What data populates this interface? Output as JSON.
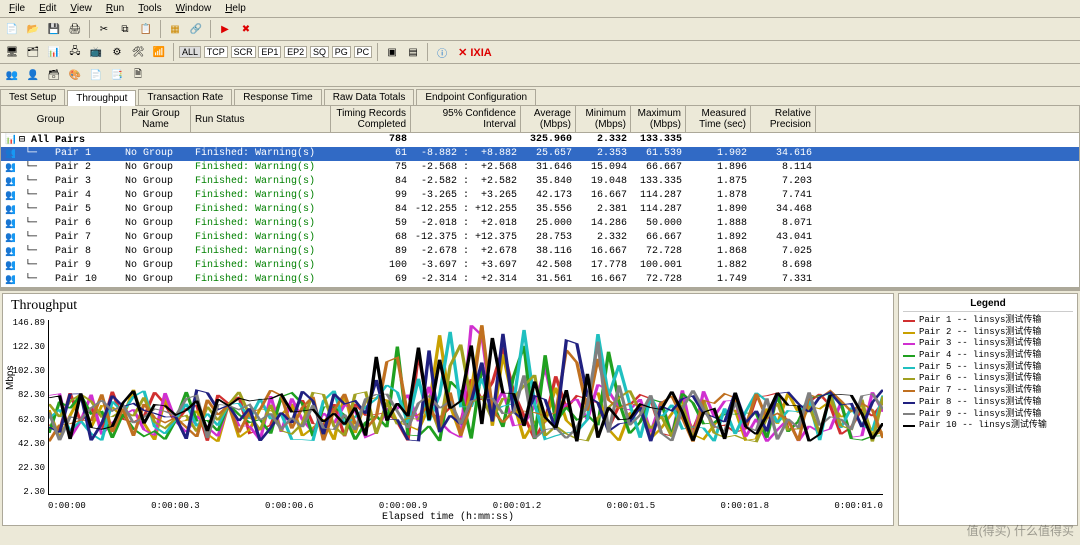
{
  "menu": [
    "File",
    "Edit",
    "View",
    "Run",
    "Tools",
    "Window",
    "Help"
  ],
  "toolbar2": {
    "modes": [
      "ALL",
      "TCP",
      "SCR",
      "EP1",
      "EP2",
      "SQ",
      "PG",
      "PC"
    ],
    "brand": "IXIA"
  },
  "tabs": [
    {
      "label": "Test Setup",
      "active": false
    },
    {
      "label": "Throughput",
      "active": true
    },
    {
      "label": "Transaction Rate",
      "active": false
    },
    {
      "label": "Response Time",
      "active": false
    },
    {
      "label": "Raw Data Totals",
      "active": false
    },
    {
      "label": "Endpoint Configuration",
      "active": false
    }
  ],
  "grid": {
    "headers": [
      "Group",
      "",
      "Pair Group Name",
      "Run Status",
      "Timing Records Completed",
      "95% Confidence Interval",
      "Average (Mbps)",
      "Minimum (Mbps)",
      "Maximum (Mbps)",
      "Measured Time (sec)",
      "Relative Precision"
    ],
    "summary": {
      "label": "All Pairs",
      "completed": "788",
      "avg": "325.960",
      "min": "2.332",
      "max": "133.335"
    },
    "rows": [
      {
        "pair": "Pair 1",
        "grp": "No Group",
        "status": "Finished: Warning(s)",
        "tr": "61",
        "ci": " -8.882 :  +8.882",
        "avg": "25.657",
        "min": "2.353",
        "max": "61.539",
        "time": "1.902",
        "prec": "34.616"
      },
      {
        "pair": "Pair 2",
        "grp": "No Group",
        "status": "Finished: Warning(s)",
        "tr": "75",
        "ci": " -2.568 :  +2.568",
        "avg": "31.646",
        "min": "15.094",
        "max": "66.667",
        "time": "1.896",
        "prec": "8.114"
      },
      {
        "pair": "Pair 3",
        "grp": "No Group",
        "status": "Finished: Warning(s)",
        "tr": "84",
        "ci": " -2.582 :  +2.582",
        "avg": "35.840",
        "min": "19.048",
        "max": "133.335",
        "time": "1.875",
        "prec": "7.203"
      },
      {
        "pair": "Pair 4",
        "grp": "No Group",
        "status": "Finished: Warning(s)",
        "tr": "99",
        "ci": " -3.265 :  +3.265",
        "avg": "42.173",
        "min": "16.667",
        "max": "114.287",
        "time": "1.878",
        "prec": "7.741"
      },
      {
        "pair": "Pair 5",
        "grp": "No Group",
        "status": "Finished: Warning(s)",
        "tr": "84",
        "ci": "-12.255 : +12.255",
        "avg": "35.556",
        "min": "2.381",
        "max": "114.287",
        "time": "1.890",
        "prec": "34.468"
      },
      {
        "pair": "Pair 6",
        "grp": "No Group",
        "status": "Finished: Warning(s)",
        "tr": "59",
        "ci": " -2.018 :  +2.018",
        "avg": "25.000",
        "min": "14.286",
        "max": "50.000",
        "time": "1.888",
        "prec": "8.071"
      },
      {
        "pair": "Pair 7",
        "grp": "No Group",
        "status": "Finished: Warning(s)",
        "tr": "68",
        "ci": "-12.375 : +12.375",
        "avg": "28.753",
        "min": "2.332",
        "max": "66.667",
        "time": "1.892",
        "prec": "43.041"
      },
      {
        "pair": "Pair 8",
        "grp": "No Group",
        "status": "Finished: Warning(s)",
        "tr": "89",
        "ci": " -2.678 :  +2.678",
        "avg": "38.116",
        "min": "16.667",
        "max": "72.728",
        "time": "1.868",
        "prec": "7.025"
      },
      {
        "pair": "Pair 9",
        "grp": "No Group",
        "status": "Finished: Warning(s)",
        "tr": "100",
        "ci": " -3.697 :  +3.697",
        "avg": "42.508",
        "min": "17.778",
        "max": "100.001",
        "time": "1.882",
        "prec": "8.698"
      },
      {
        "pair": "Pair 10",
        "grp": "No Group",
        "status": "Finished: Warning(s)",
        "tr": "69",
        "ci": " -2.314 :  +2.314",
        "avg": "31.561",
        "min": "16.667",
        "max": "72.728",
        "time": "1.749",
        "prec": "7.331"
      }
    ]
  },
  "chart": {
    "title": "Throughput",
    "ylabel": "Mbps",
    "xlabel": "Elapsed time (h:mm:ss)",
    "yticks": [
      "146.89",
      "122.30",
      "102.30",
      "82.30",
      "62.30",
      "42.30",
      "22.30",
      "2.30"
    ],
    "xticks": [
      "0:00:00",
      "0:00:00.3",
      "0:00:00.6",
      "0:00:00.9",
      "0:00:01.2",
      "0:00:01.5",
      "0:00:01.8",
      "0:00:01.0"
    ],
    "legend_title": "Legend",
    "legend": [
      {
        "name": "Pair 1 -- linsys测试传输",
        "color": "#d03030"
      },
      {
        "name": "Pair 2 -- linsys测试传输",
        "color": "#c8a000"
      },
      {
        "name": "Pair 3 -- linsys测试传输",
        "color": "#d030d0"
      },
      {
        "name": "Pair 4 -- linsys测试传输",
        "color": "#20a020"
      },
      {
        "name": "Pair 5 -- linsys测试传输",
        "color": "#20c0c0"
      },
      {
        "name": "Pair 6 -- linsys测试传输",
        "color": "#a0a020"
      },
      {
        "name": "Pair 7 -- linsys测试传输",
        "color": "#c07020"
      },
      {
        "name": "Pair 8 -- linsys测试传输",
        "color": "#202080"
      },
      {
        "name": "Pair 9 -- linsys测试传输",
        "color": "#808080"
      },
      {
        "name": "Pair 10 -- linsys测试传输",
        "color": "#000000"
      }
    ]
  },
  "chart_data": {
    "type": "line",
    "title": "Throughput",
    "xlabel": "Elapsed time (h:mm:ss)",
    "ylabel": "Mbps",
    "ylim": [
      2.3,
      146.89
    ],
    "xrange": [
      0.0,
      2.0
    ],
    "series": [
      {
        "name": "Pair 1",
        "color": "#d03030"
      },
      {
        "name": "Pair 2",
        "color": "#c8a000"
      },
      {
        "name": "Pair 3",
        "color": "#d030d0"
      },
      {
        "name": "Pair 4",
        "color": "#20a020"
      },
      {
        "name": "Pair 5",
        "color": "#20c0c0"
      },
      {
        "name": "Pair 6",
        "color": "#a0a020"
      },
      {
        "name": "Pair 7",
        "color": "#c07020"
      },
      {
        "name": "Pair 8",
        "color": "#202080"
      },
      {
        "name": "Pair 9",
        "color": "#808080"
      },
      {
        "name": "Pair 10",
        "color": "#000000"
      }
    ],
    "note": "per-point values not individually readable; series oscillate roughly 20–60 Mbps with spikes to 100–145 Mbps near t≈0.9–1.3s"
  },
  "watermark": "值(得买) 什么值得买"
}
